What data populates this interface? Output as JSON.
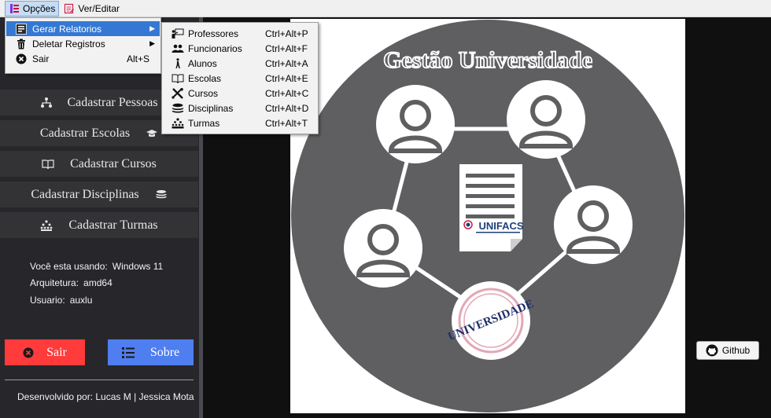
{
  "menubar": {
    "opcoes_label": "Opções",
    "ver_editar_label": "Ver/Editar"
  },
  "dropdown": {
    "items": [
      {
        "label": "Gerar Relatorios",
        "accelerator": "",
        "icon": "report-icon"
      },
      {
        "label": "Deletar Registros",
        "accelerator": "",
        "icon": "trash-icon"
      },
      {
        "label": "Sair",
        "accelerator": "Alt+S",
        "icon": "close-circle-icon"
      }
    ]
  },
  "submenu": {
    "items": [
      {
        "label": "Professores",
        "accelerator": "Ctrl+Alt+P",
        "icon": "teacher-icon"
      },
      {
        "label": "Funcionarios",
        "accelerator": "Ctrl+Alt+F",
        "icon": "people-icon"
      },
      {
        "label": "Alunos",
        "accelerator": "Ctrl+Alt+A",
        "icon": "walking-person-icon"
      },
      {
        "label": "Escolas",
        "accelerator": "Ctrl+Alt+E",
        "icon": "book-icon"
      },
      {
        "label": "Cursos",
        "accelerator": "Ctrl+Alt+C",
        "icon": "tools-icon"
      },
      {
        "label": "Disciplinas",
        "accelerator": "Ctrl+Alt+D",
        "icon": "layers-icon"
      },
      {
        "label": "Turmas",
        "accelerator": "Ctrl+Alt+T",
        "icon": "group-icon"
      }
    ]
  },
  "sidebar": {
    "buttons": [
      {
        "label": "Cadastrar Pessoas",
        "icon": "org-chart-icon"
      },
      {
        "label": "Cadastrar Escolas",
        "icon": "graduation-cap-icon"
      },
      {
        "label": "Cadastrar Cursos",
        "icon": "book-open-icon"
      },
      {
        "label": "Cadastrar Disciplinas",
        "icon": "layers-icon"
      },
      {
        "label": "Cadastrar Turmas",
        "icon": "group-icon"
      }
    ],
    "sysinfo": [
      {
        "label": "Você esta usando:",
        "value": "Windows 11"
      },
      {
        "label": "Arquitetura:",
        "value": "amd64"
      },
      {
        "label": "Usuario:",
        "value": "auxlu"
      }
    ],
    "sair_label": "Sair",
    "sobre_label": "Sobre",
    "credits": "Desenvolvido por: Lucas M | Jessica Mota"
  },
  "logo": {
    "title": "Gestão Universidade",
    "brand": "UNIFACS",
    "seal_text": "UNIVERSIDADE"
  },
  "github_label": "Github",
  "colors": {
    "sidebar_bg": "#27272b",
    "sidebar_button_bg": "#333336",
    "sair_button": "#ff3b3b",
    "sobre_button": "#4f7ef0",
    "menu_highlight": "#3478d3",
    "logo_circle": "#5f5f61"
  }
}
